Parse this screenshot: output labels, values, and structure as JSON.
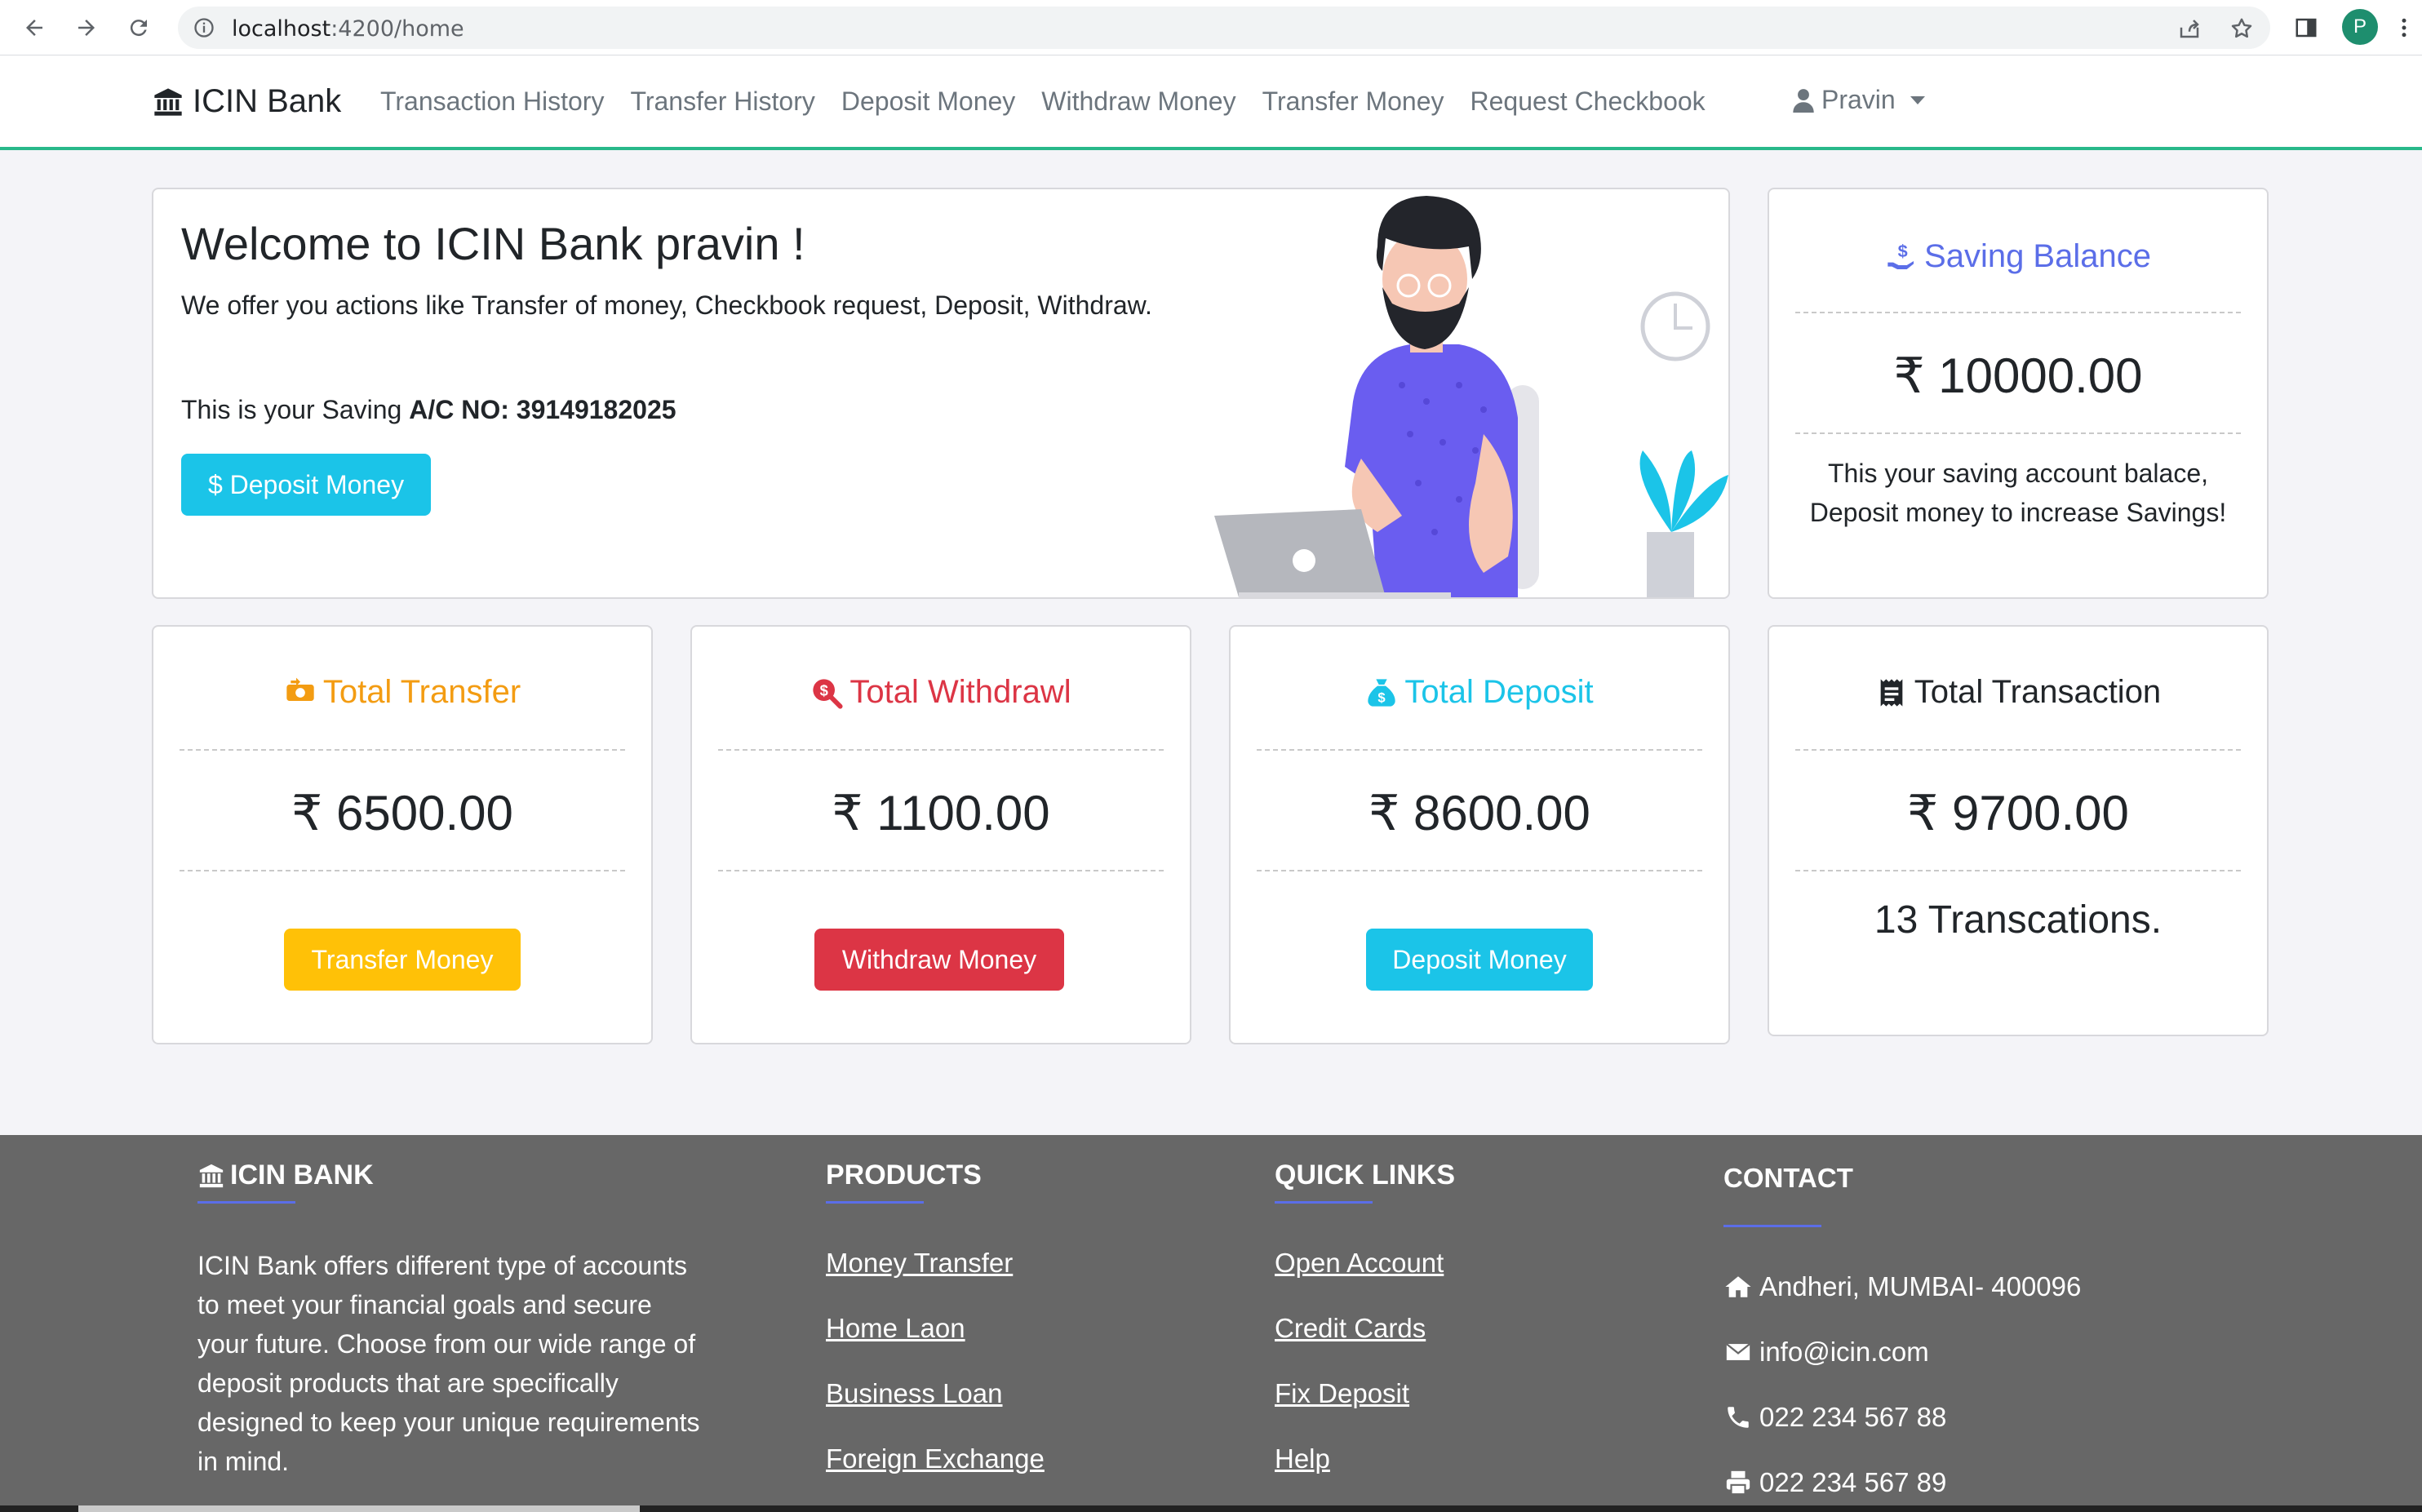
{
  "browser": {
    "url_host": "localhost",
    "url_rest": ":4200/home",
    "profile_initial": "P"
  },
  "navbar": {
    "brand": "ICIN Bank",
    "links": [
      "Transaction History",
      "Transfer History",
      "Deposit Money",
      "Withdraw Money",
      "Transfer Money",
      "Request Checkbook"
    ],
    "user": "Pravin"
  },
  "welcome": {
    "title": "Welcome to ICIN Bank pravin !",
    "subtitle": "We offer you actions like Transfer of money, Checkbook request, Deposit, Withdraw.",
    "account_prefix": "This is your Saving ",
    "account_label": "A/C NO: 39149182025",
    "deposit_button": "$ Deposit Money"
  },
  "saving": {
    "title": "Saving Balance",
    "amount": "₹ 10000.00",
    "note_line1": "This your saving account balace,",
    "note_line2": "Deposit money to increase Savings!"
  },
  "stats": {
    "transfer": {
      "title": "Total Transfer",
      "amount": "₹ 6500.00",
      "button": "Transfer Money"
    },
    "withdrawl": {
      "title": "Total Withdrawl",
      "amount": "₹ 1100.00",
      "button": "Withdraw Money"
    },
    "deposit": {
      "title": "Total Deposit",
      "amount": "₹ 8600.00",
      "button": "Deposit Money"
    },
    "transaction": {
      "title": "Total Transaction",
      "amount": "₹ 9700.00",
      "count_text": "13 Transcations."
    }
  },
  "colors": {
    "accent_green": "#28b88a",
    "saving_purple": "#5b6ee8",
    "transfer_orange": "#f39c12",
    "withdrawl_red": "#dc3545",
    "deposit_cyan": "#1bc4e8",
    "footer_gray": "#676767"
  },
  "footer": {
    "about_title": "ICIN BANK",
    "about_text": "ICIN Bank offers different type of accounts to meet your financial goals and secure your future. Choose from our wide range of deposit products that are specifically designed to keep your unique requirements in mind.",
    "products_title": "PRODUCTS",
    "products": [
      "Money Transfer",
      "Home Laon",
      "Business Loan",
      "Foreign Exchange"
    ],
    "quick_title": "QUICK LINKS",
    "quick_links": [
      "Open Account",
      "Credit Cards",
      "Fix Deposit",
      "Help"
    ],
    "contact_title": "CONTACT",
    "address": "Andheri, MUMBAI- 400096",
    "email": "info@icin.com",
    "phone": "022 234 567 88",
    "fax": "022 234 567 89"
  }
}
